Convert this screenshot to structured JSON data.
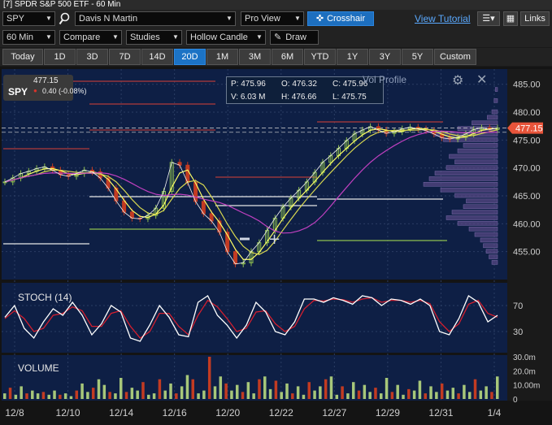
{
  "window": {
    "title": "[7] SPDR S&P 500 ETF - 60 Min"
  },
  "toolbar1": {
    "symbol": "SPY",
    "account": "Davis N Martin",
    "view": "Pro View",
    "crosshair": "Crosshair",
    "tutorial": "View Tutorial",
    "links": "Links"
  },
  "toolbar2": {
    "interval": "60 Min",
    "compare": "Compare",
    "studies": "Studies",
    "candle": "Hollow Candle",
    "draw": "Draw"
  },
  "ranges": [
    "Today",
    "1D",
    "3D",
    "7D",
    "14D",
    "20D",
    "1M",
    "3M",
    "6M",
    "YTD",
    "1Y",
    "3Y",
    "5Y",
    "Custom"
  ],
  "active_range": "20D",
  "quote": {
    "symbol": "SPY",
    "price": "477.15",
    "change": "0.40 (-0.08%)"
  },
  "ohlc": {
    "p": "P: 475.96",
    "o": "O: 476.32",
    "c": "C: 475.96",
    "v": "V: 6.03 M",
    "h": "H: 476.66",
    "l": "L: 475.75"
  },
  "vol_profile_title": "Vol Profile",
  "colors": {
    "background": "#0e1f45",
    "up": "#8fbf4f",
    "down": "#c23b22",
    "accent": "#1c73c5",
    "last_price": "#e8543a",
    "stoch_k": "#ffffff",
    "stoch_d": "#d21f2f"
  },
  "chart_data": [
    {
      "type": "line",
      "title": "",
      "ylim": [
        450,
        487
      ],
      "y_ticks": [
        "485.00",
        "480.00",
        "475.00",
        "470.00",
        "465.00",
        "460.00",
        "455.00"
      ],
      "last_price_label": "477.15",
      "x_labels": [
        "12/8",
        "12/10",
        "12/14",
        "12/16",
        "12/20",
        "12/22",
        "12/27",
        "12/29",
        "12/31",
        "1/4"
      ],
      "series": [
        {
          "values": [
            467.5,
            468.2,
            469.0,
            469.4,
            469.9,
            470.2,
            469.6,
            468.8,
            468.5,
            469.0,
            469.6,
            469.3,
            468.2,
            466.4,
            464.1,
            462.1,
            461.0,
            460.9,
            461.5,
            462.8,
            465.8,
            471.0,
            470.5,
            467.4,
            464.0,
            461.8,
            460.5,
            458.5,
            455.0,
            452.8,
            453.0,
            455.0,
            456.6,
            458.8,
            461.0,
            463.0,
            464.6,
            466.0,
            467.5,
            469.2,
            471.0,
            472.2,
            473.5,
            474.9,
            476.1,
            476.8,
            477.4,
            476.8,
            476.2,
            476.5,
            477.0,
            477.3,
            477.0,
            476.7,
            476.1,
            475.4,
            475.2,
            475.5,
            476.1,
            476.9,
            477.2,
            476.9,
            477.15
          ]
        }
      ]
    },
    {
      "type": "line",
      "title": "STOCH (14)",
      "ylim": [
        0,
        100
      ],
      "y_ticks": [
        "70",
        "30"
      ],
      "series": [
        {
          "values": [
            52,
            70,
            35,
            20,
            45,
            65,
            55,
            75,
            55,
            25,
            42,
            70,
            60,
            20,
            15,
            40,
            70,
            52,
            25,
            22,
            75,
            85,
            55,
            40,
            20,
            40,
            75,
            60,
            30,
            25,
            45,
            80,
            80,
            75,
            82,
            78,
            72,
            85,
            82,
            70,
            80,
            78,
            72,
            80,
            70,
            30,
            25,
            50,
            85,
            75,
            45,
            55
          ]
        },
        {
          "values": [
            50,
            62,
            50,
            30,
            35,
            55,
            58,
            68,
            62,
            38,
            38,
            58,
            62,
            38,
            20,
            30,
            58,
            58,
            38,
            25,
            55,
            78,
            68,
            50,
            30,
            35,
            60,
            62,
            42,
            30,
            38,
            65,
            78,
            77,
            80,
            79,
            75,
            80,
            82,
            75,
            78,
            78,
            75,
            78,
            73,
            45,
            30,
            42,
            72,
            78,
            58,
            52
          ]
        }
      ]
    },
    {
      "type": "bar",
      "title": "VOLUME",
      "ylim": [
        0,
        30
      ],
      "y_ticks": [
        "30.0m",
        "20.0m",
        "10.00m",
        "0"
      ],
      "values": [
        4,
        8,
        3,
        9,
        4,
        6,
        4,
        5,
        3,
        6,
        3,
        4,
        2,
        6,
        11,
        5,
        8,
        14,
        10,
        5,
        4,
        15,
        5,
        8,
        6,
        12,
        3,
        4,
        14,
        6,
        11,
        4,
        9,
        17,
        14,
        4,
        6,
        33,
        9,
        16,
        11,
        6,
        10,
        5,
        12,
        4,
        14,
        16,
        7,
        13,
        5,
        11,
        4,
        9,
        3,
        12,
        6,
        9,
        14,
        16,
        3,
        9,
        4,
        12,
        6,
        10,
        5,
        8,
        4,
        15,
        5,
        10,
        3,
        7,
        6,
        13,
        4,
        9,
        5,
        11,
        6,
        8,
        4,
        10,
        5,
        14,
        6,
        9,
        5,
        16
      ]
    }
  ]
}
